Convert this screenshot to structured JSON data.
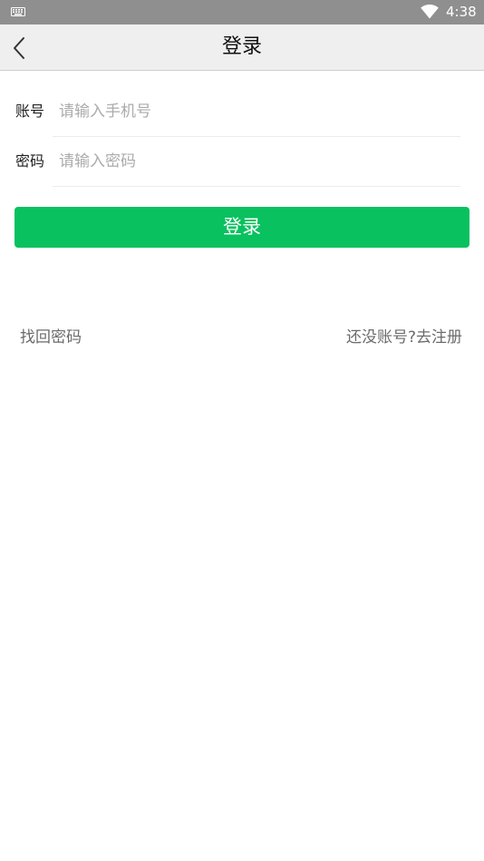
{
  "status_bar": {
    "time": "4:38",
    "icons": [
      "keyboard-icon",
      "wifi-icon"
    ]
  },
  "header": {
    "title": "登录",
    "back_icon": "chevron-left-icon"
  },
  "form": {
    "account": {
      "label": "账号",
      "value": "",
      "placeholder": "请输入手机号"
    },
    "password": {
      "label": "密码",
      "value": "",
      "placeholder": "请输入密码"
    },
    "login_label": "登录"
  },
  "links": {
    "forgot_password": "找回密码",
    "register": "还没账号?去注册"
  },
  "colors": {
    "status_bar": "#8f8f8f",
    "header_bg": "#efefef",
    "primary": "#09c15f",
    "link_text": "#6b6b6b",
    "placeholder": "#ababab"
  }
}
